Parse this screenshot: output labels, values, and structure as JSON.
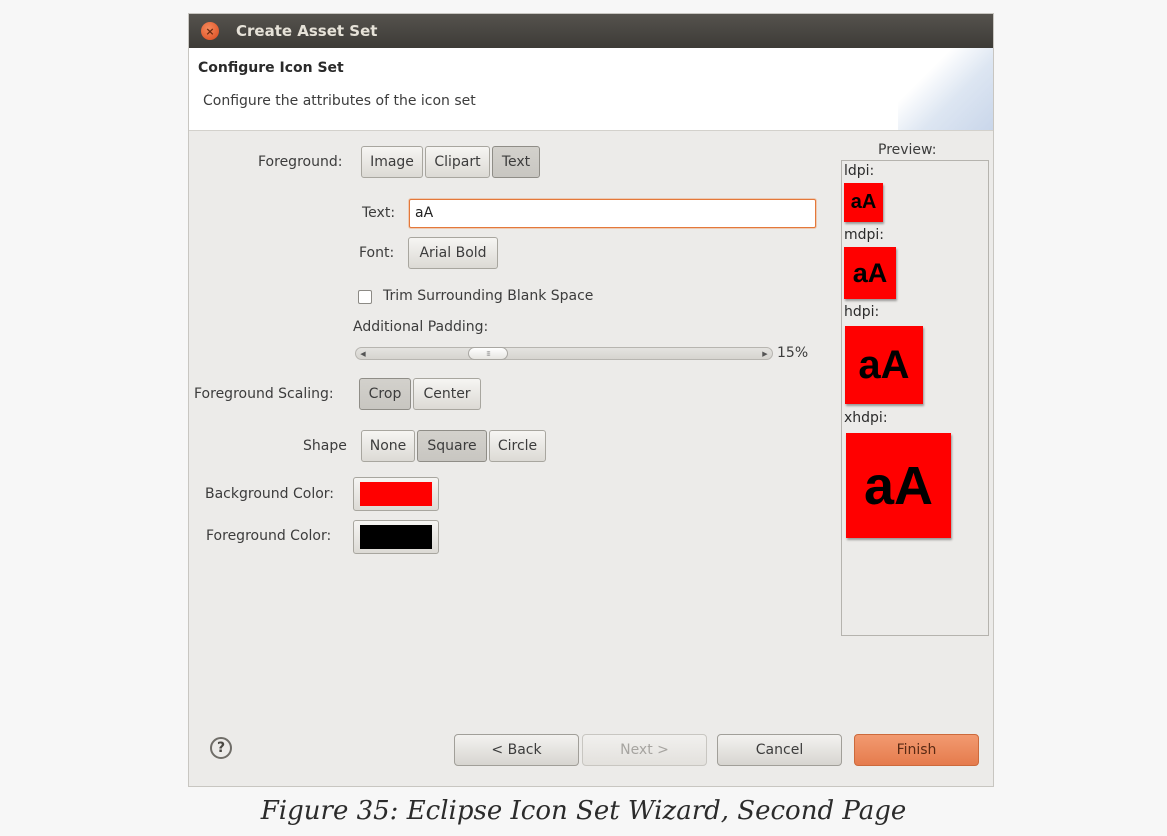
{
  "window": {
    "title": "Create Asset Set"
  },
  "header": {
    "title": "Configure Icon Set",
    "description": "Configure the attributes of the icon set"
  },
  "foreground": {
    "label": "Foreground:",
    "options": [
      "Image",
      "Clipart",
      "Text"
    ],
    "selected": "Text"
  },
  "text_field": {
    "label": "Text:",
    "value": "aA"
  },
  "font": {
    "label": "Font:",
    "value": "Arial Bold"
  },
  "trim": {
    "label": "Trim Surrounding Blank Space",
    "checked": false
  },
  "padding": {
    "label": "Additional Padding:",
    "value_text": "15%",
    "value": 15
  },
  "scaling": {
    "label": "Foreground Scaling:",
    "options": [
      "Crop",
      "Center"
    ],
    "selected": "Crop"
  },
  "shape": {
    "label": "Shape",
    "options": [
      "None",
      "Square",
      "Circle"
    ],
    "selected": "Square"
  },
  "background_color": {
    "label": "Background Color:",
    "value": "#ff0000"
  },
  "foreground_color": {
    "label": "Foreground Color:",
    "value": "#000000"
  },
  "preview": {
    "label": "Preview:",
    "densities": [
      {
        "label": "ldpi:",
        "icon_text": "aA"
      },
      {
        "label": "mdpi:",
        "icon_text": "aA"
      },
      {
        "label": "hdpi:",
        "icon_text": "aA"
      },
      {
        "label": "xhdpi:",
        "icon_text": "aA"
      }
    ]
  },
  "footer": {
    "help_icon": "help-icon",
    "back": "< Back",
    "next": "Next >",
    "cancel": "Cancel",
    "finish": "Finish"
  },
  "caption": "Figure 35: Eclipse Icon Set Wizard, Second Page"
}
